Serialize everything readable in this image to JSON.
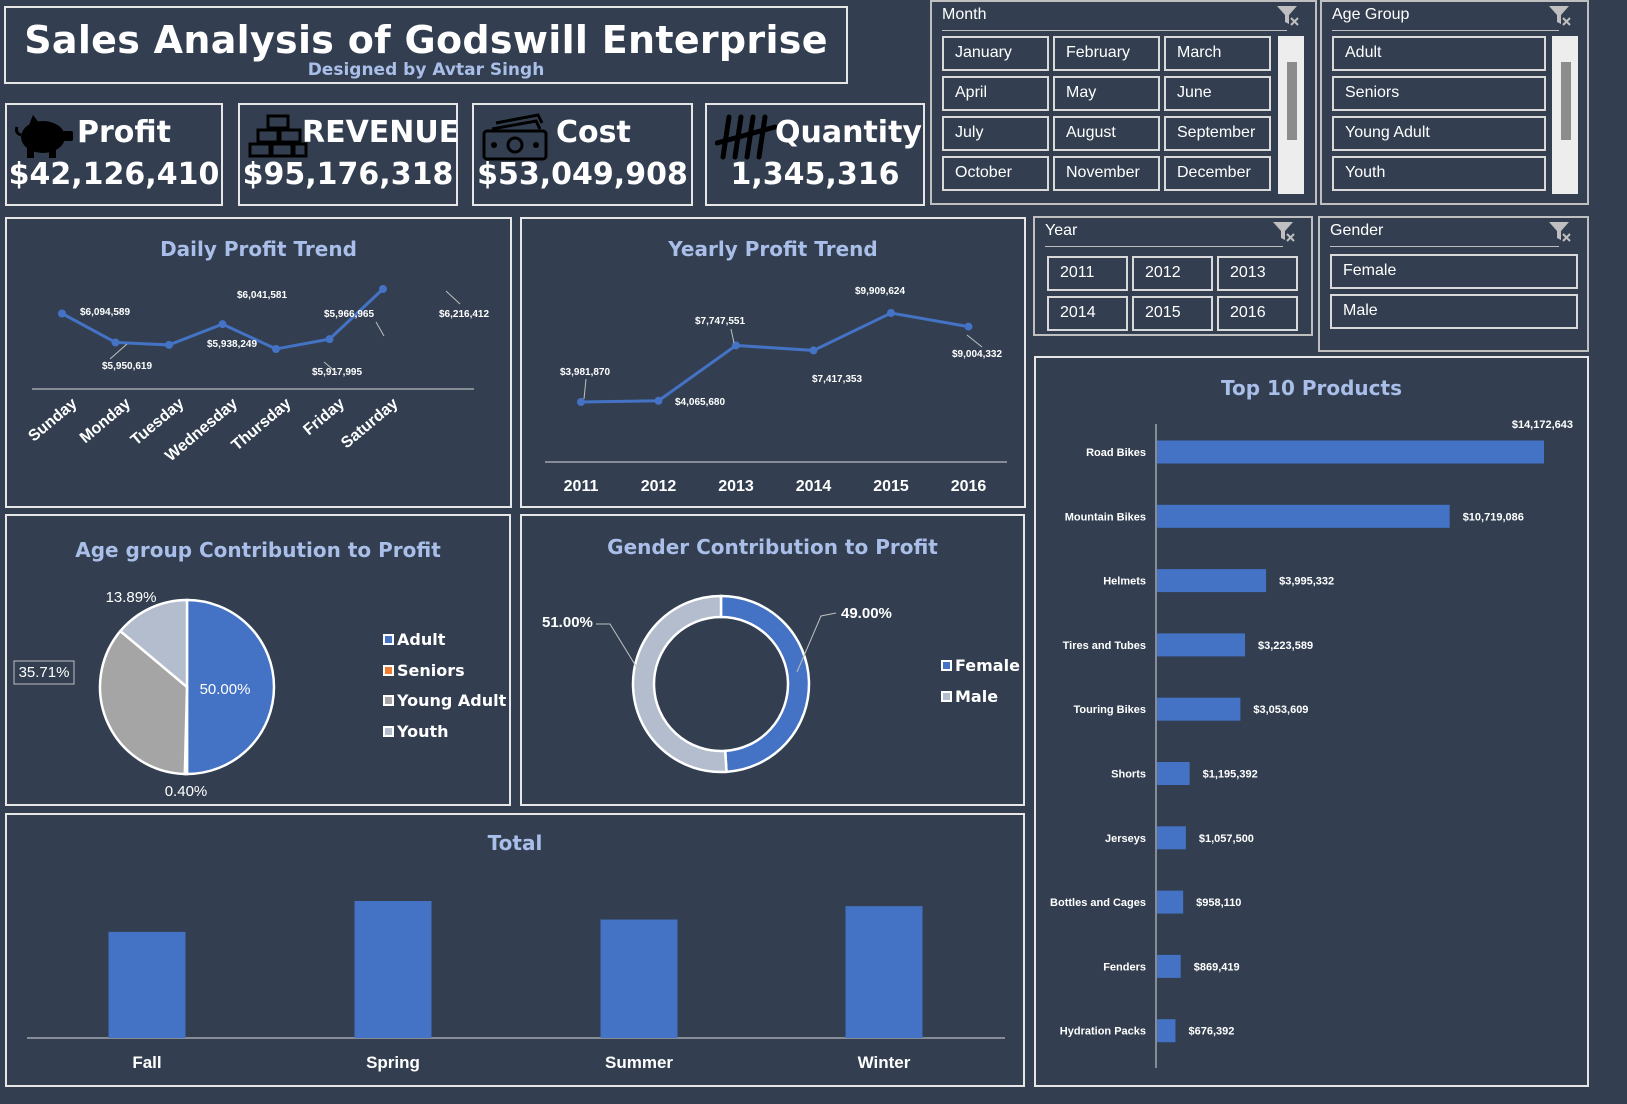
{
  "header": {
    "title": "Sales Analysis of Godswill Enterprise",
    "subtitle": "Designed by Avtar Singh"
  },
  "kpis": {
    "profit": {
      "label": "Profit",
      "value": "$42,126,410",
      "icon": "piggy-bank-icon"
    },
    "revenue": {
      "label": "REVENUE",
      "value": "$95,176,318",
      "icon": "gold-bars-icon"
    },
    "cost": {
      "label": "Cost",
      "value": "$53,049,908",
      "icon": "cash-icon"
    },
    "quantity": {
      "label": "Quantity",
      "value": "1,345,316",
      "icon": "tally-icon"
    }
  },
  "slicers": {
    "month": {
      "header": "Month",
      "items": [
        "January",
        "February",
        "March",
        "April",
        "May",
        "June",
        "July",
        "August",
        "September",
        "October",
        "November",
        "December"
      ]
    },
    "age_group": {
      "header": "Age Group",
      "items": [
        "Adult",
        "Seniors",
        "Young Adult",
        "Youth"
      ]
    },
    "year": {
      "header": "Year",
      "items": [
        "2011",
        "2012",
        "2013",
        "2014",
        "2015",
        "2016"
      ]
    },
    "gender": {
      "header": "Gender",
      "items": [
        "Female",
        "Male"
      ]
    }
  },
  "colors": {
    "background": "#333F50",
    "accent": "#4472C4",
    "title": "#A9BEE8",
    "grey": "#A5A5A5",
    "light_grey": "#B4BDCE",
    "orange": "#ED7D31"
  },
  "chart_data": [
    {
      "id": "daily",
      "type": "line",
      "title": "Daily Profit Trend",
      "categories": [
        "Sunday",
        "Monday",
        "Tuesday",
        "Wednesday",
        "Thursday",
        "Friday",
        "Saturday"
      ],
      "values": [
        6094589,
        5950619,
        5938249,
        6041581,
        5917995,
        5966965,
        6216412
      ],
      "labels": [
        "$6,094,589",
        "$5,950,619",
        "$5,938,249",
        "$6,041,581",
        "$5,917,995",
        "$5,966,965",
        "$6,216,412"
      ]
    },
    {
      "id": "yearly",
      "type": "line",
      "title": "Yearly Profit Trend",
      "categories": [
        "2011",
        "2012",
        "2013",
        "2014",
        "2015",
        "2016"
      ],
      "values": [
        3981870,
        4065680,
        7747551,
        7417353,
        9909624,
        9004332
      ],
      "labels": [
        "$3,981,870",
        "$4,065,680",
        "$7,747,551",
        "$7,417,353",
        "$9,909,624",
        "$9,004,332"
      ]
    },
    {
      "id": "age",
      "type": "pie",
      "title": "Age group Contribution to Profit",
      "categories": [
        "Adult",
        "Seniors",
        "Young Adult",
        "Youth"
      ],
      "values": [
        50.0,
        0.4,
        35.71,
        13.89
      ],
      "labels": [
        "50.00%",
        "0.40%",
        "35.71%",
        "13.89%"
      ],
      "colors": [
        "#4472C4",
        "#ED7D31",
        "#A5A5A5",
        "#B4BDCE"
      ],
      "legend": "right"
    },
    {
      "id": "gender",
      "type": "pie",
      "title": "Gender Contribution to Profit",
      "categories": [
        "Female",
        "Male"
      ],
      "values": [
        49.0,
        51.0
      ],
      "labels": [
        "49.00%",
        "51.00%"
      ],
      "colors": [
        "#4472C4",
        "#B4BDCE"
      ],
      "legend": "right"
    },
    {
      "id": "season",
      "type": "bar",
      "title": "Total",
      "categories": [
        "Fall",
        "Spring",
        "Summer",
        "Winter"
      ],
      "values": [
        10300000,
        13300000,
        11500000,
        12800000
      ]
    },
    {
      "id": "products",
      "type": "bar",
      "title": "Top 10 Products",
      "categories": [
        "Road Bikes",
        "Mountain Bikes",
        "Helmets",
        "Tires and Tubes",
        "Touring Bikes",
        "Shorts",
        "Jerseys",
        "Bottles and Cages",
        "Fenders",
        "Hydration Packs"
      ],
      "values": [
        14172643,
        10719086,
        3995332,
        3223589,
        3053609,
        1195392,
        1057500,
        958110,
        869419,
        676392
      ],
      "labels": [
        "$14,172,643",
        "$10,719,086",
        "$3,995,332",
        "$3,223,589",
        "$3,053,609",
        "$1,195,392",
        "$1,057,500",
        "$958,110",
        "$869,419",
        "$676,392"
      ]
    }
  ]
}
